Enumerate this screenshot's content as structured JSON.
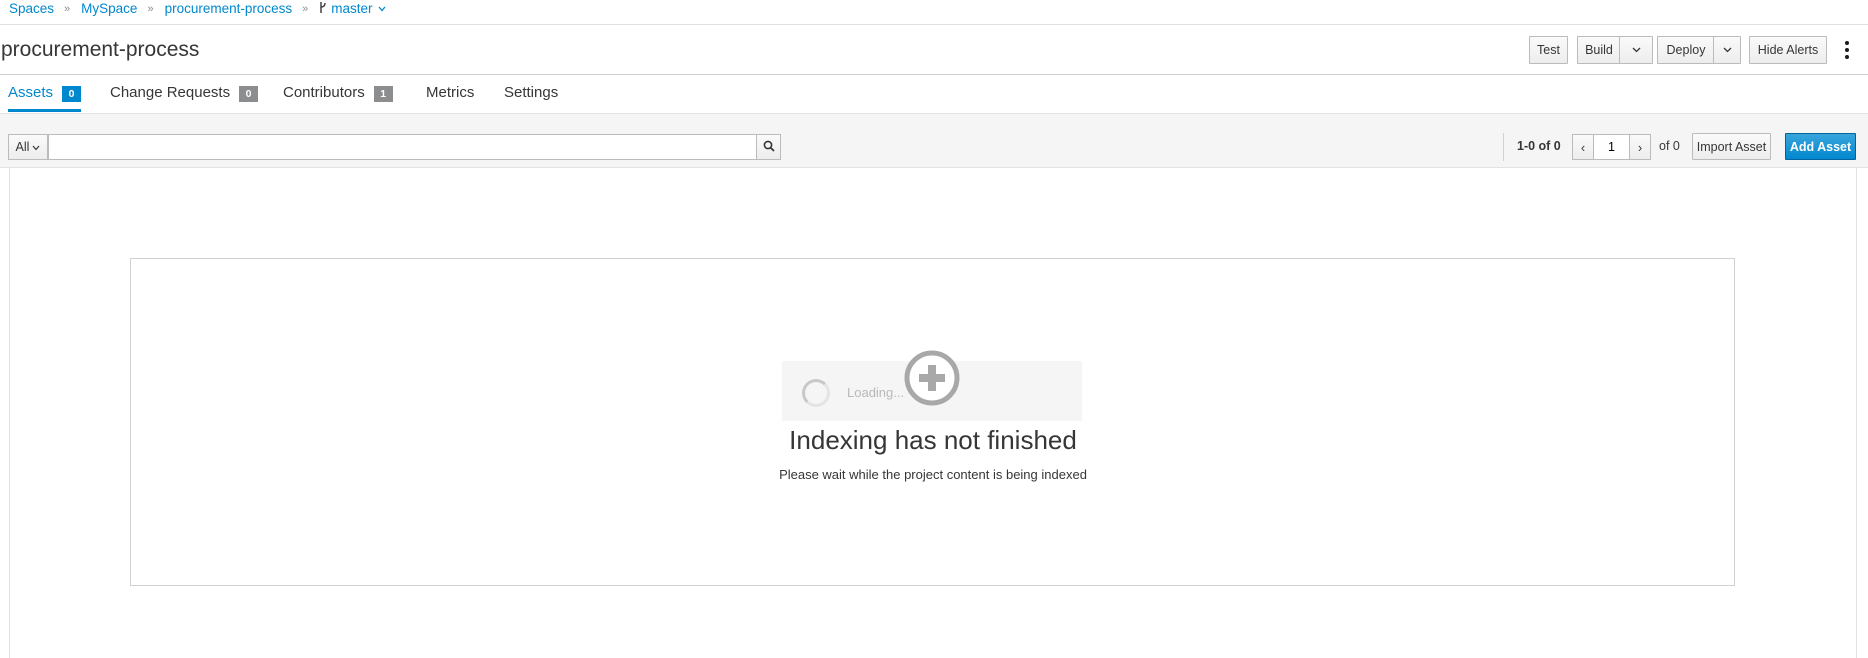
{
  "breadcrumb": {
    "items": [
      "Spaces",
      "MySpace",
      "procurement-process"
    ],
    "separator": "»",
    "branch": "master"
  },
  "header": {
    "title": "procurement-process",
    "actions": {
      "test": "Test",
      "build": "Build",
      "deploy": "Deploy",
      "hide_alerts": "Hide Alerts"
    }
  },
  "tabs": [
    {
      "label": "Assets",
      "badge": "0",
      "active": true
    },
    {
      "label": "Change Requests",
      "badge": "0"
    },
    {
      "label": "Contributors",
      "badge": "1"
    },
    {
      "label": "Metrics"
    },
    {
      "label": "Settings"
    }
  ],
  "toolbar": {
    "filter": "All",
    "search_value": "",
    "range": "1-0 of 0",
    "page": "1",
    "prev": "‹",
    "next": "›",
    "of_pages": "of 0",
    "import_label": "Import Asset",
    "add_label": "Add Asset"
  },
  "empty_state": {
    "loading": "Loading...",
    "title": "Indexing has not finished",
    "description": "Please wait while the project content is being indexed"
  },
  "colors": {
    "accent": "#0088ce",
    "badge_gray": "#8b8d8f",
    "text": "#363636"
  },
  "icons": [
    "branch-icon",
    "chevron-down-icon",
    "search-icon",
    "add-circle-icon",
    "spinner-icon",
    "kebab-icon"
  ]
}
